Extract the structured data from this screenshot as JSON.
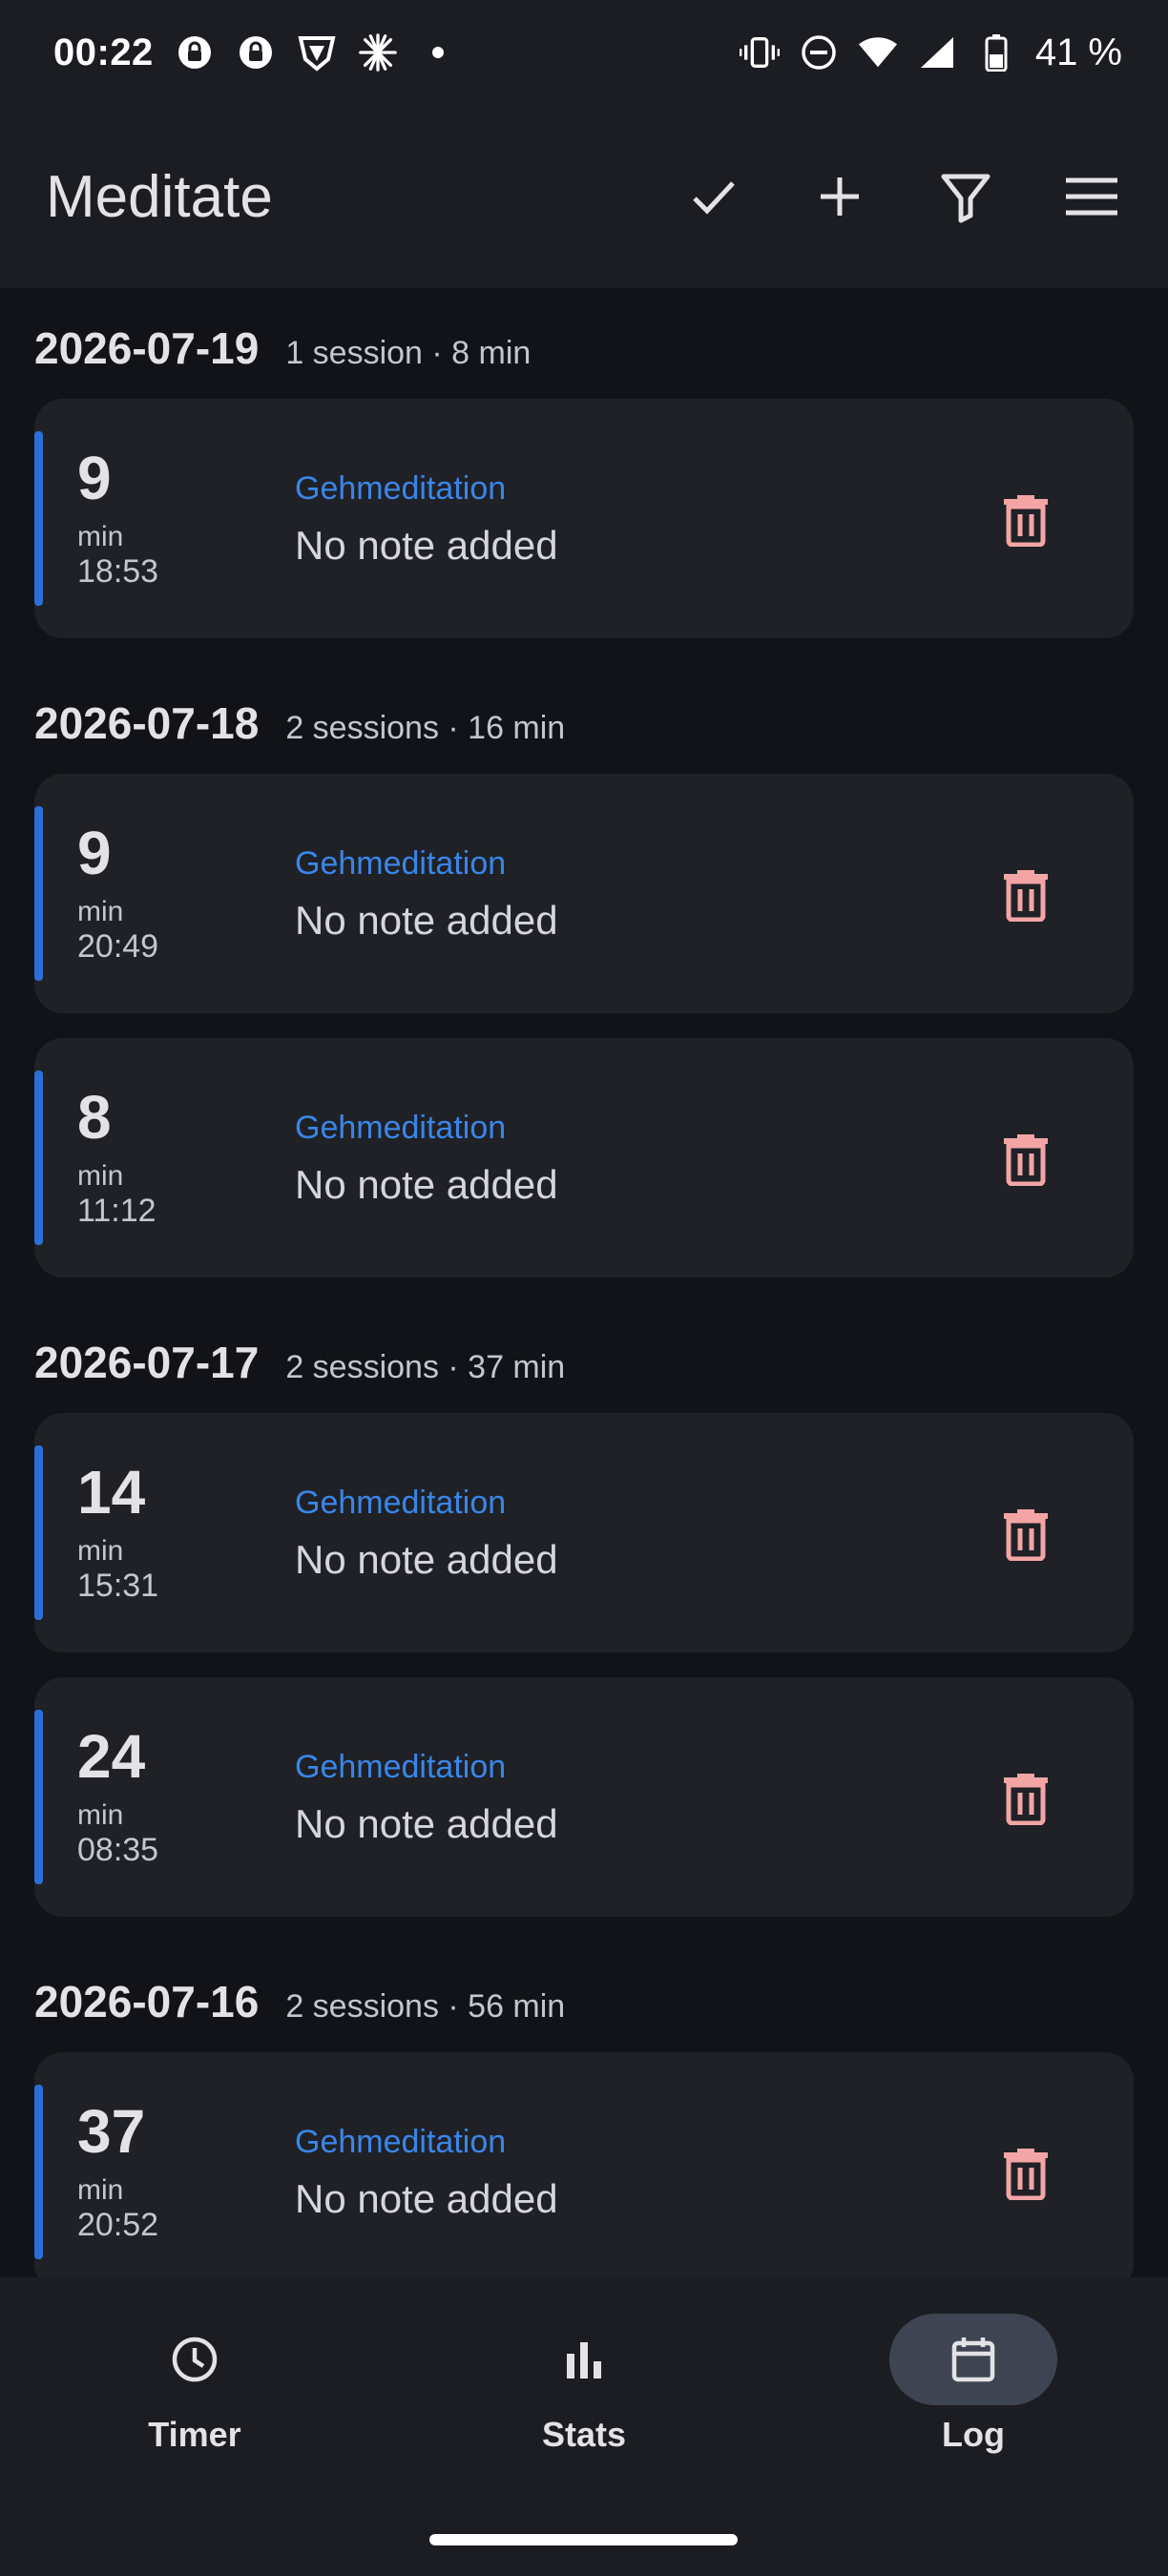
{
  "status_bar": {
    "time": "00:22",
    "battery_text": "41 %",
    "left_icons": [
      "lock-chat-icon",
      "lock-chat-icon",
      "vpn-shield-icon",
      "sparkle-icon",
      "dot-icon"
    ],
    "right_icons": [
      "vibrate-icon",
      "do-not-disturb-icon",
      "wifi-icon",
      "cell-signal-icon",
      "battery-icon"
    ]
  },
  "app_bar": {
    "title": "Meditate",
    "actions": [
      "check-icon",
      "add-icon",
      "filter-icon",
      "menu-icon"
    ]
  },
  "log": {
    "groups": [
      {
        "date": "2026-07-19",
        "summary": "1 session · 8 min",
        "sessions": [
          {
            "minutes": "9",
            "unit": "min",
            "time": "18:53",
            "tag": "Gehmeditation",
            "note": "No note added"
          }
        ]
      },
      {
        "date": "2026-07-18",
        "summary": "2 sessions · 16 min",
        "sessions": [
          {
            "minutes": "9",
            "unit": "min",
            "time": "20:49",
            "tag": "Gehmeditation",
            "note": "No note added"
          },
          {
            "minutes": "8",
            "unit": "min",
            "time": "11:12",
            "tag": "Gehmeditation",
            "note": "No note added"
          }
        ]
      },
      {
        "date": "2026-07-17",
        "summary": "2 sessions · 37 min",
        "sessions": [
          {
            "minutes": "14",
            "unit": "min",
            "time": "15:31",
            "tag": "Gehmeditation",
            "note": "No note added"
          },
          {
            "minutes": "24",
            "unit": "min",
            "time": "08:35",
            "tag": "Gehmeditation",
            "note": "No note added"
          }
        ]
      },
      {
        "date": "2026-07-16",
        "summary": "2 sessions · 56 min",
        "sessions": [
          {
            "minutes": "37",
            "unit": "min",
            "time": "20:52",
            "tag": "Gehmeditation",
            "note": "No note added"
          }
        ]
      }
    ]
  },
  "bottom_nav": {
    "items": [
      {
        "label": "Timer",
        "icon": "clock-icon",
        "active": false
      },
      {
        "label": "Stats",
        "icon": "bar-chart-icon",
        "active": false
      },
      {
        "label": "Log",
        "icon": "calendar-icon",
        "active": true
      }
    ]
  },
  "colors": {
    "background": "#111318",
    "surface": "#1f2127",
    "accent_blue": "#2c6fd6",
    "tag_blue": "#3a86e8",
    "delete_pink": "#f3a5a5",
    "active_pill": "#3e4452"
  }
}
